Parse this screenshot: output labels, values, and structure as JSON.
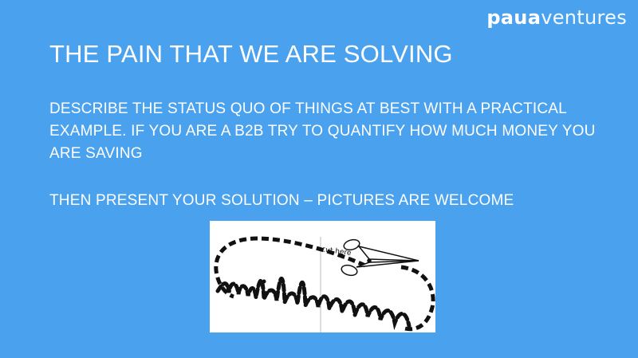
{
  "logo": {
    "part1": "paua",
    "part2": "ventures"
  },
  "title": "THE PAIN THAT WE ARE SOLVING",
  "paragraph1": "DESCRIBE THE STATUS QUO OF THINGS AT BEST WITH A PRACTICAL EXAMPLE. IF YOU ARE A B2B TRY TO QUANTIFY HOW MUCH MONEY YOU ARE SAVING",
  "paragraph2": "THEN PRESENT YOUR SOLUTION – PICTURES ARE WELCOME",
  "illustration": {
    "cut_text": "cut here",
    "word": "middleman"
  }
}
